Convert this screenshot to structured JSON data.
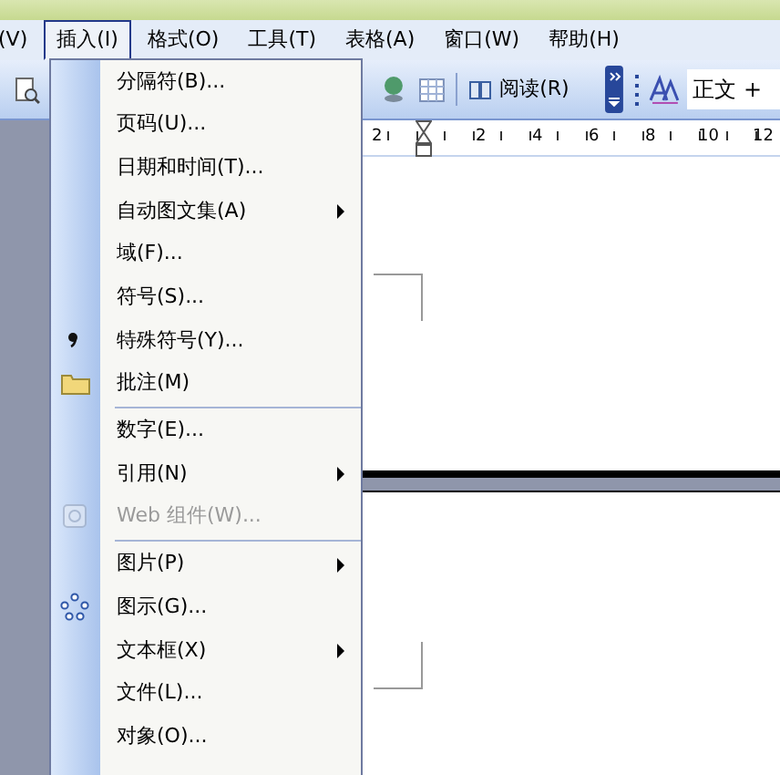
{
  "menubar": [
    {
      "label": "(V)",
      "selected": false
    },
    {
      "label": "插入(I)",
      "selected": true
    },
    {
      "label": "格式(O)",
      "selected": false
    },
    {
      "label": "工具(T)",
      "selected": false
    },
    {
      "label": "表格(A)",
      "selected": false
    },
    {
      "label": "窗口(W)",
      "selected": false
    },
    {
      "label": "帮助(H)",
      "selected": false
    }
  ],
  "toolbar": {
    "read_button": "阅读(R)",
    "style_box": "正文 +"
  },
  "ruler": {
    "labels": [
      "2",
      "2",
      "4",
      "6",
      "8",
      "10",
      "12"
    ]
  },
  "insert_menu": [
    {
      "kind": "item",
      "label": "分隔符(B)...",
      "submenu": false,
      "disabled": false
    },
    {
      "kind": "item",
      "label": "页码(U)...",
      "submenu": false,
      "disabled": false
    },
    {
      "kind": "item",
      "label": "日期和时间(T)...",
      "submenu": false,
      "disabled": false
    },
    {
      "kind": "item",
      "label": "自动图文集(A)",
      "submenu": true,
      "disabled": false
    },
    {
      "kind": "item",
      "label": "域(F)...",
      "submenu": false,
      "disabled": false
    },
    {
      "kind": "item",
      "label": "符号(S)...",
      "submenu": false,
      "disabled": false
    },
    {
      "kind": "item",
      "label": "特殊符号(Y)...",
      "submenu": false,
      "disabled": false
    },
    {
      "kind": "item",
      "label": "批注(M)",
      "submenu": false,
      "disabled": false
    },
    {
      "kind": "separator"
    },
    {
      "kind": "item",
      "label": "数字(E)...",
      "submenu": false,
      "disabled": false
    },
    {
      "kind": "item",
      "label": "引用(N)",
      "submenu": true,
      "disabled": false
    },
    {
      "kind": "item",
      "label": "Web 组件(W)...",
      "submenu": false,
      "disabled": true
    },
    {
      "kind": "separator"
    },
    {
      "kind": "item",
      "label": "图片(P)",
      "submenu": true,
      "disabled": false
    },
    {
      "kind": "item",
      "label": "图示(G)...",
      "submenu": false,
      "disabled": false
    },
    {
      "kind": "item",
      "label": "文本框(X)",
      "submenu": true,
      "disabled": false
    },
    {
      "kind": "item",
      "label": "文件(L)...",
      "submenu": false,
      "disabled": false
    },
    {
      "kind": "item",
      "label": "对象(O)...",
      "submenu": false,
      "disabled": false
    }
  ]
}
